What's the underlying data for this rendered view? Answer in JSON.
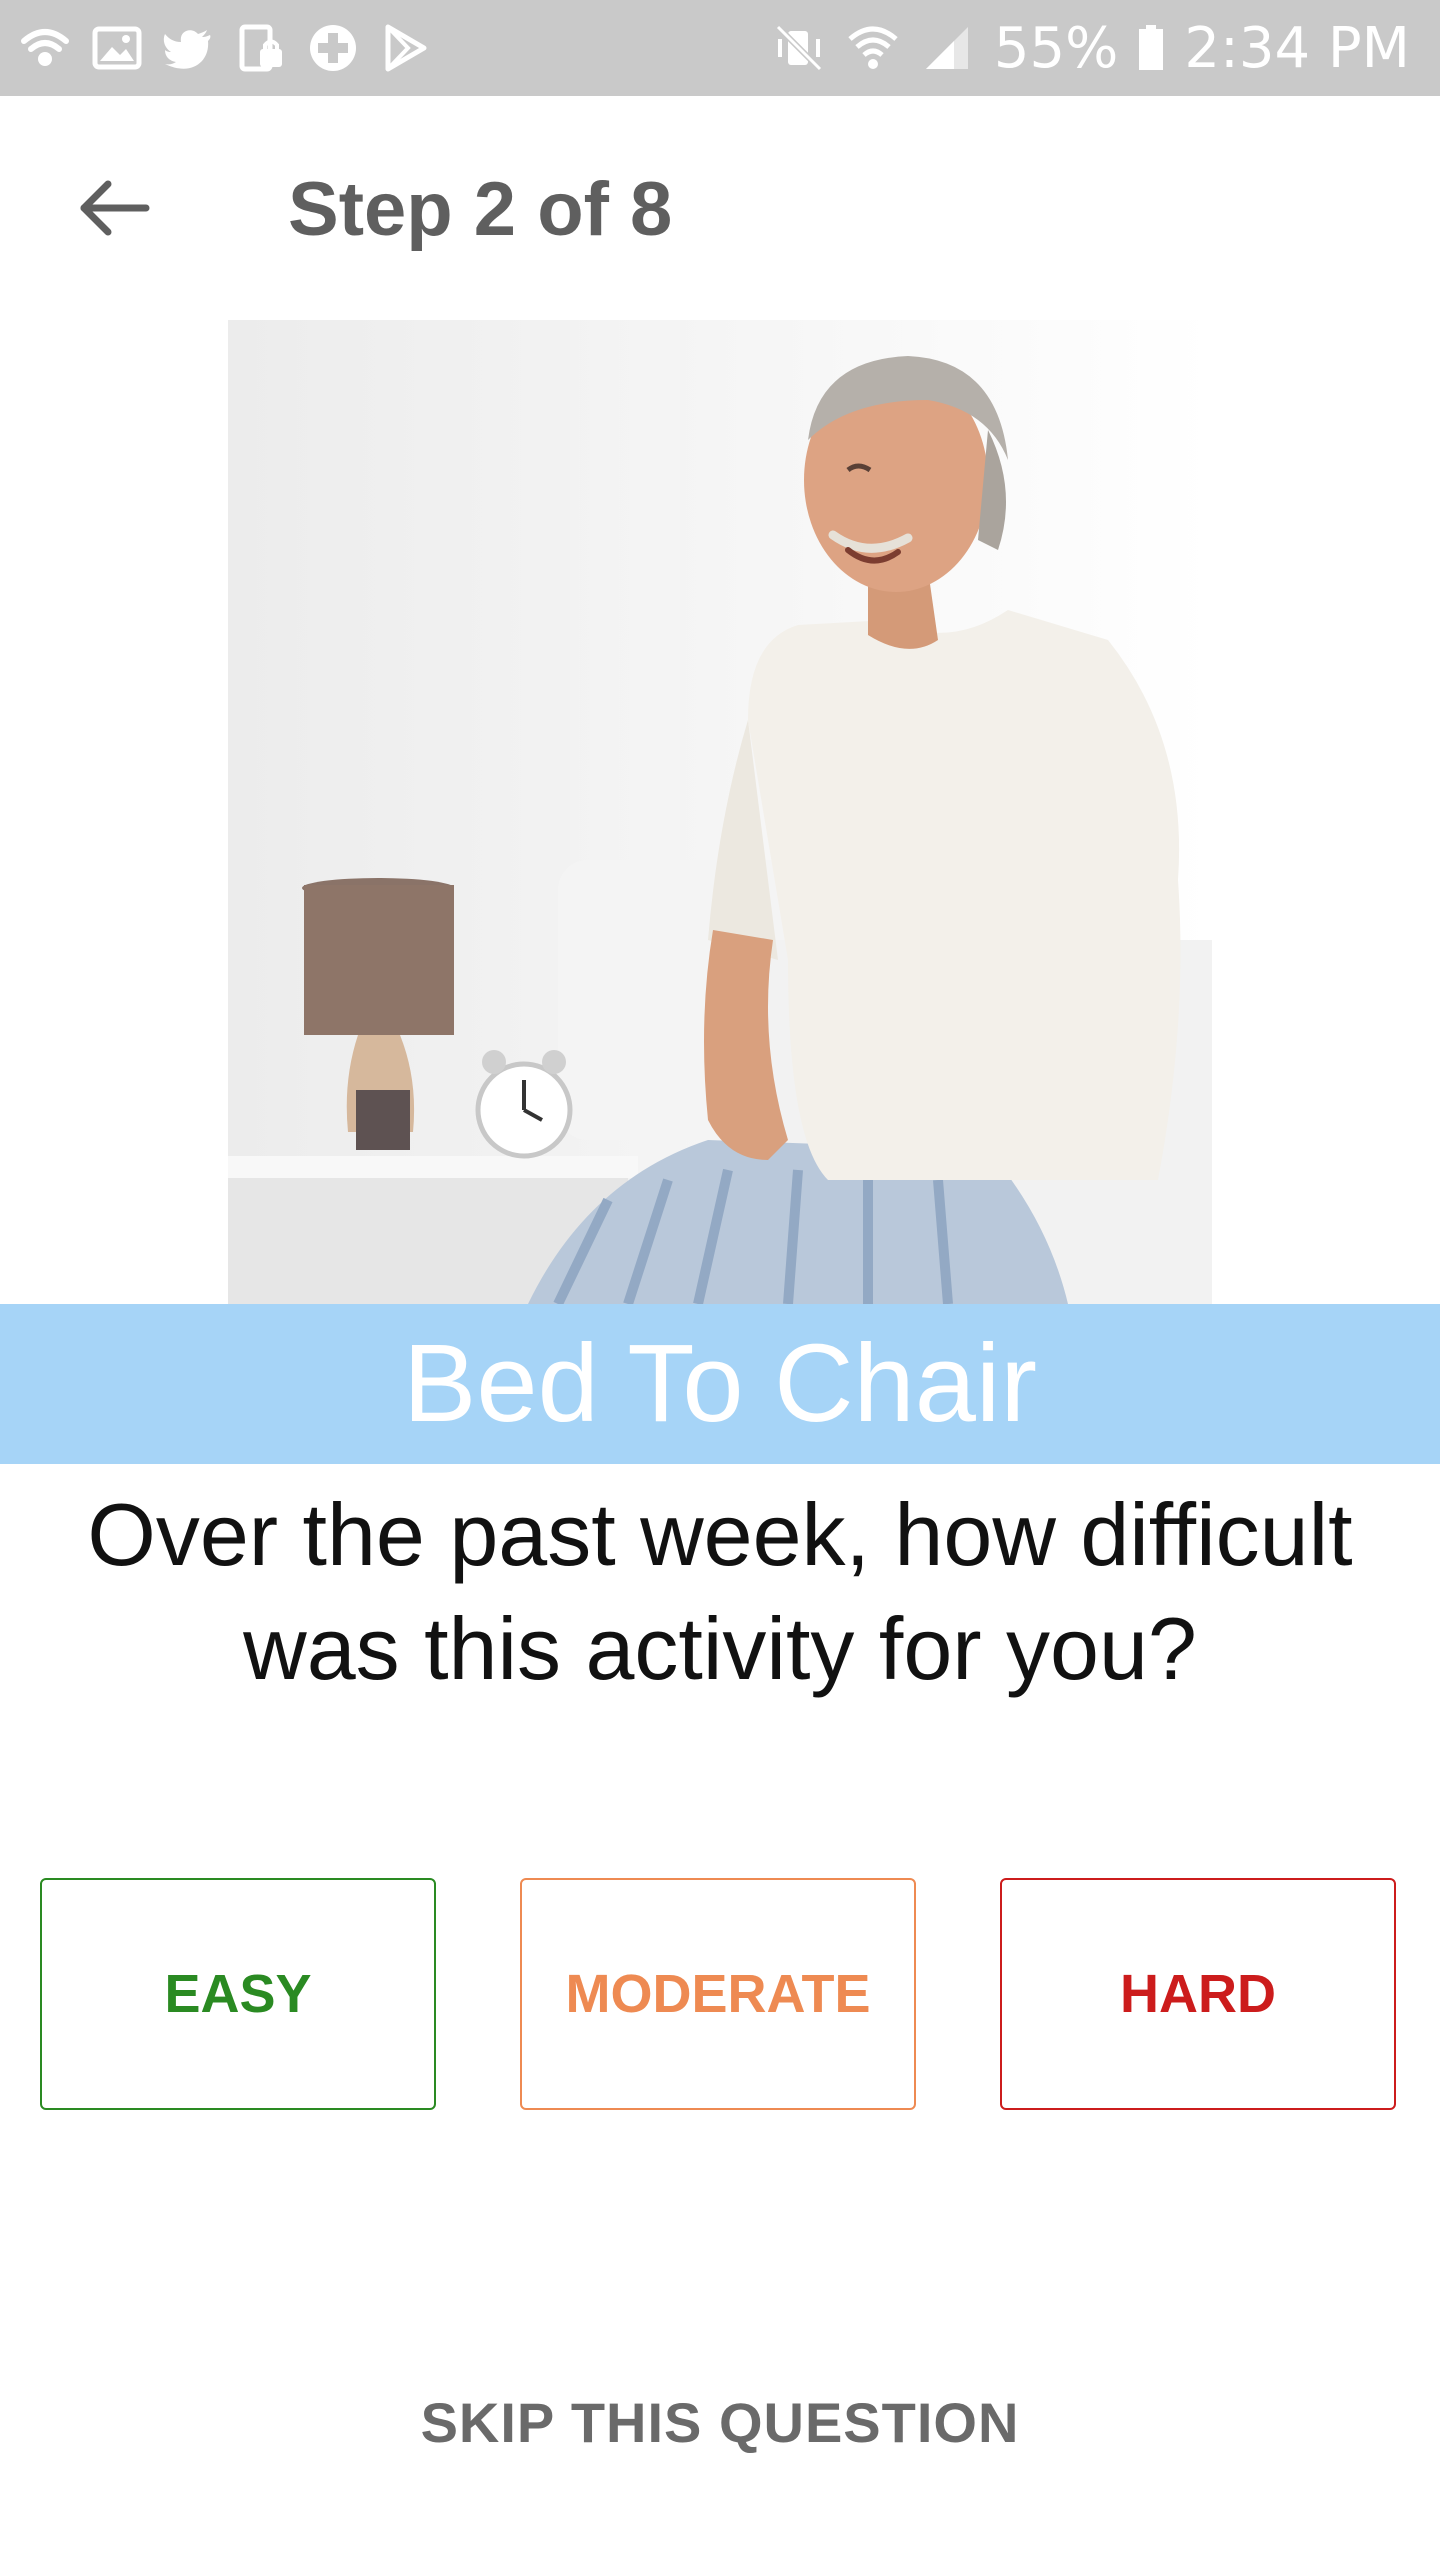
{
  "status_bar": {
    "left_icons": [
      "wifi-calling-icon",
      "gallery-icon",
      "twitter-icon",
      "phone-lock-icon",
      "health-plus-icon",
      "play-store-icon"
    ],
    "right_icons": [
      "vibrate-mute-icon",
      "wifi-icon",
      "cell-signal-icon",
      "battery-icon"
    ],
    "battery_text": "55%",
    "time": "2:34 PM"
  },
  "toolbar": {
    "back_icon": "arrow-left-icon",
    "title": "Step 2 of 8"
  },
  "activity": {
    "image_icon": "man-sitting-on-bed-photo",
    "title": "Bed To Chair"
  },
  "question": {
    "text": "Over the past week, how difficult was this activity for you?"
  },
  "answers": [
    {
      "label": "EASY",
      "color": "#2a8a22"
    },
    {
      "label": "MODERATE",
      "color": "#ee8a52"
    },
    {
      "label": "HARD",
      "color": "#cc1c1c"
    }
  ],
  "skip": {
    "label": "SKIP THIS QUESTION"
  },
  "colors": {
    "status_bar_bg": "#c9c9c9",
    "banner_bg": "#a6d4f7",
    "title_text": "#5f5f5f"
  }
}
